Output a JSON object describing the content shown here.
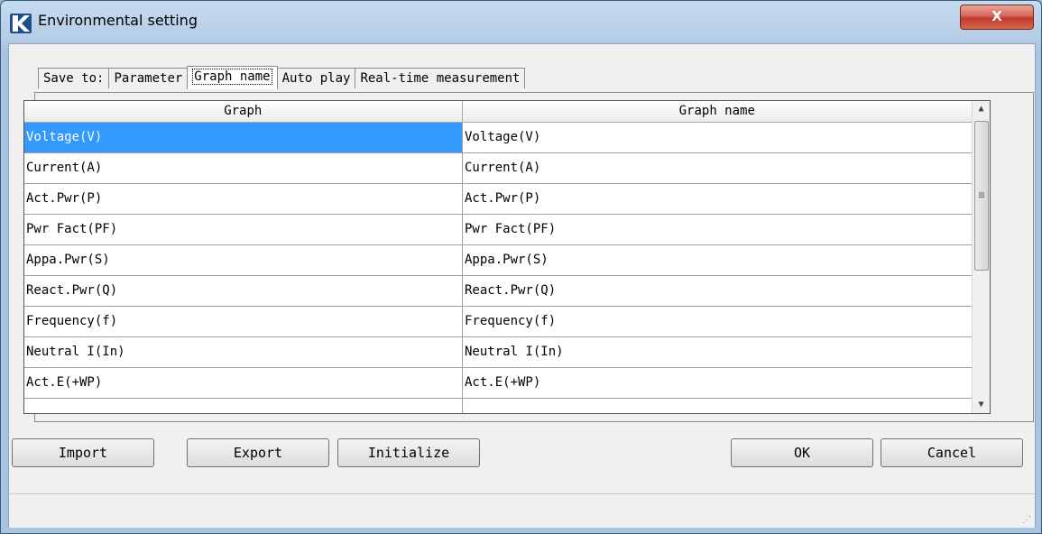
{
  "window": {
    "title": "Environmental setting",
    "close_label": "X"
  },
  "tabs": [
    {
      "label": "Save to:"
    },
    {
      "label": "Parameter"
    },
    {
      "label": "Graph name",
      "active": true
    },
    {
      "label": "Auto play"
    },
    {
      "label": "Real-time measurement"
    }
  ],
  "table": {
    "columns": [
      "Graph",
      "Graph name"
    ],
    "rows": [
      {
        "graph": "Voltage(V)",
        "name": "Voltage(V)"
      },
      {
        "graph": "Current(A)",
        "name": "Current(A)"
      },
      {
        "graph": "Act.Pwr(P)",
        "name": "Act.Pwr(P)"
      },
      {
        "graph": "Pwr Fact(PF)",
        "name": "Pwr Fact(PF)"
      },
      {
        "graph": "Appa.Pwr(S)",
        "name": "Appa.Pwr(S)"
      },
      {
        "graph": "React.Pwr(Q)",
        "name": "React.Pwr(Q)"
      },
      {
        "graph": "Frequency(f)",
        "name": "Frequency(f)"
      },
      {
        "graph": "Neutral I(In)",
        "name": "Neutral I(In)"
      },
      {
        "graph": "Act.E(+WP)",
        "name": "Act.E(+WP)"
      }
    ],
    "selected_row": 0
  },
  "buttons": {
    "import": "Import",
    "export": "Export",
    "initialize": "Initialize",
    "ok": "OK",
    "cancel": "Cancel"
  },
  "colors": {
    "selection": "#3399ff",
    "close_button": "#c0392b"
  },
  "icons": {
    "app": "kyoritsu-logo-icon",
    "scroll_up": "arrow-up-icon",
    "scroll_down": "arrow-down-icon",
    "scroll_grip": "grip-lines-icon",
    "size_grip": "resize-grip-icon"
  }
}
